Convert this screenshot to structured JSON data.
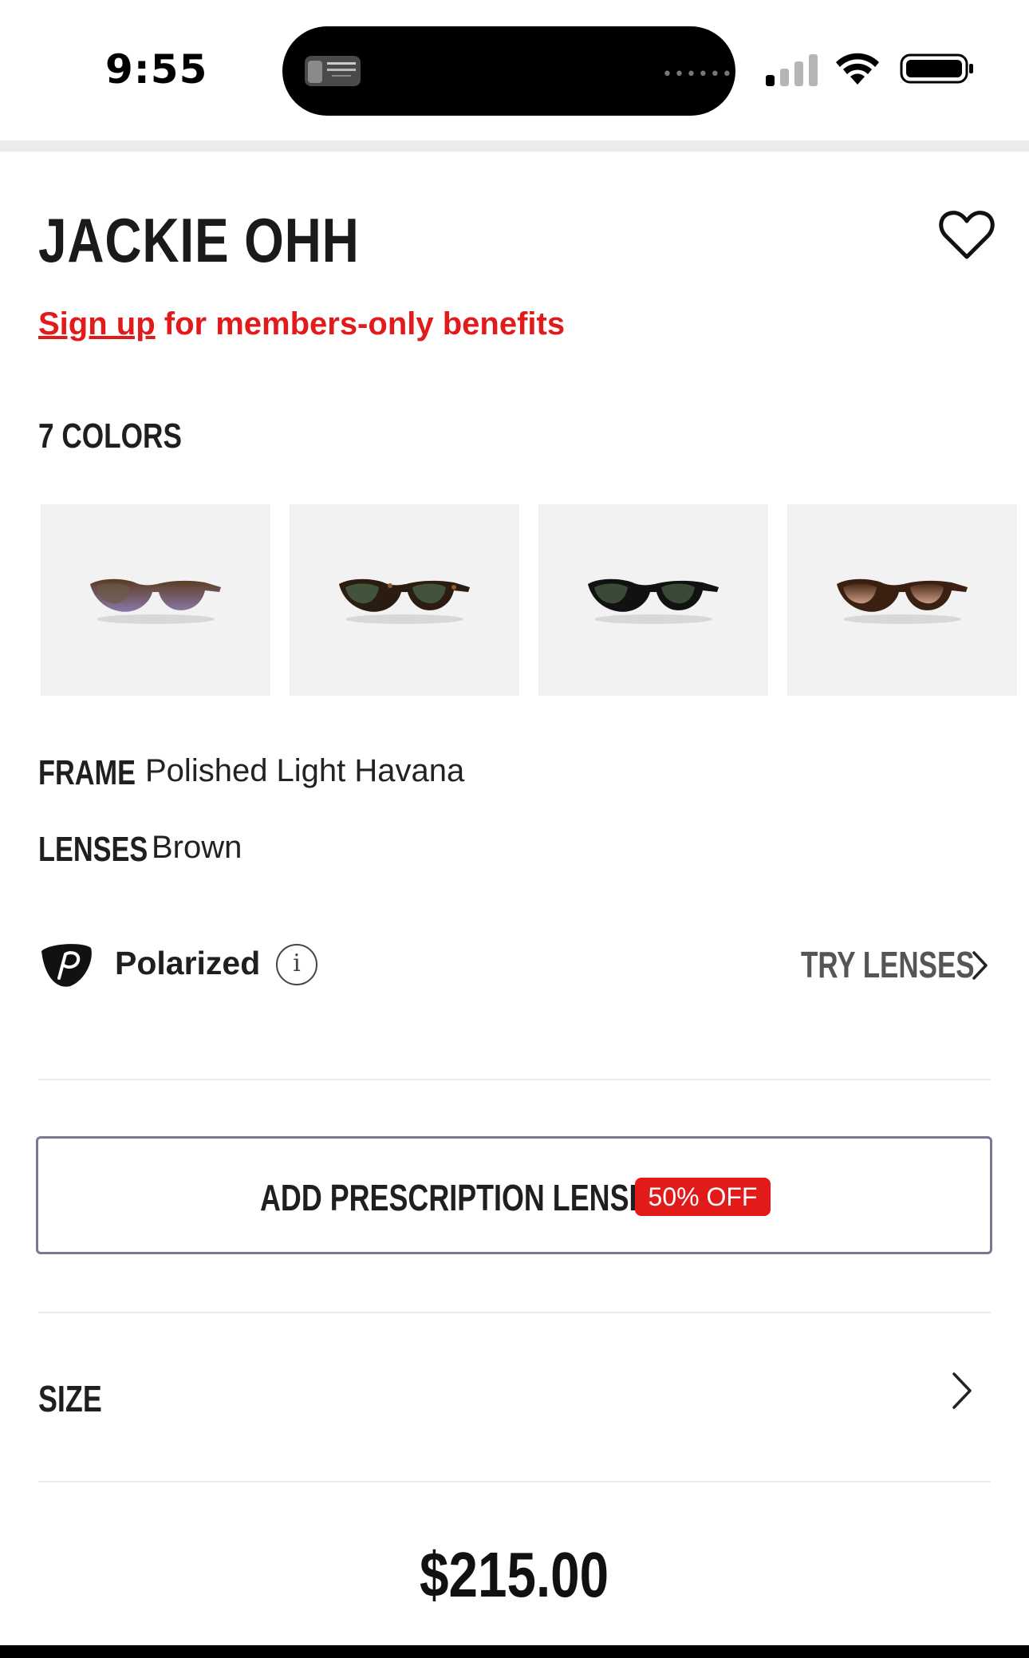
{
  "status_bar": {
    "time": "9:55"
  },
  "product": {
    "title": "JACKIE OHH",
    "signup_link": "Sign up",
    "signup_rest": " for members-only benefits",
    "colors_label": "7 COLORS",
    "swatches": [
      {
        "name": "brown-gradient-on-violet"
      },
      {
        "name": "havana-green"
      },
      {
        "name": "black-green"
      },
      {
        "name": "havana-brown-gradient"
      }
    ],
    "frame_label": "FRAME",
    "frame_value": "Polished Light Havana",
    "lenses_label": "LENSES",
    "lenses_value": "Brown",
    "polarized_label": "Polarized",
    "info_icon_glyph": "i",
    "try_lenses_label": "TRY LENSES",
    "prescription_label": "ADD PRESCRIPTION LENSES",
    "prescription_badge": "50% OFF",
    "size_label": "SIZE",
    "price": "$215.00"
  },
  "colors": {
    "accent_red": "#e21a1a",
    "text_dark": "#1f1f1f",
    "swatch_bg": "#f2f2f2",
    "divider": "#ececec"
  },
  "icons": {
    "wishlist": "heart-outline-icon",
    "polarized": "polarized-p-icon",
    "info": "info-circle-icon",
    "chevron": "chevron-right-icon"
  }
}
